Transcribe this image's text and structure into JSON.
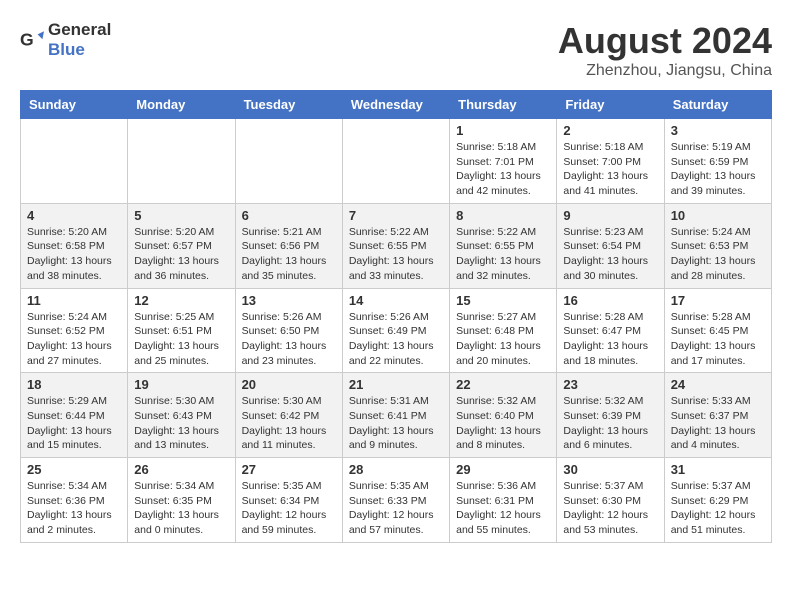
{
  "header": {
    "logo_general": "General",
    "logo_blue": "Blue",
    "title": "August 2024",
    "subtitle": "Zhenzhou, Jiangsu, China"
  },
  "weekdays": [
    "Sunday",
    "Monday",
    "Tuesday",
    "Wednesday",
    "Thursday",
    "Friday",
    "Saturday"
  ],
  "weeks": [
    [
      {
        "day": "",
        "info": ""
      },
      {
        "day": "",
        "info": ""
      },
      {
        "day": "",
        "info": ""
      },
      {
        "day": "",
        "info": ""
      },
      {
        "day": "1",
        "info": "Sunrise: 5:18 AM\nSunset: 7:01 PM\nDaylight: 13 hours\nand 42 minutes."
      },
      {
        "day": "2",
        "info": "Sunrise: 5:18 AM\nSunset: 7:00 PM\nDaylight: 13 hours\nand 41 minutes."
      },
      {
        "day": "3",
        "info": "Sunrise: 5:19 AM\nSunset: 6:59 PM\nDaylight: 13 hours\nand 39 minutes."
      }
    ],
    [
      {
        "day": "4",
        "info": "Sunrise: 5:20 AM\nSunset: 6:58 PM\nDaylight: 13 hours\nand 38 minutes."
      },
      {
        "day": "5",
        "info": "Sunrise: 5:20 AM\nSunset: 6:57 PM\nDaylight: 13 hours\nand 36 minutes."
      },
      {
        "day": "6",
        "info": "Sunrise: 5:21 AM\nSunset: 6:56 PM\nDaylight: 13 hours\nand 35 minutes."
      },
      {
        "day": "7",
        "info": "Sunrise: 5:22 AM\nSunset: 6:55 PM\nDaylight: 13 hours\nand 33 minutes."
      },
      {
        "day": "8",
        "info": "Sunrise: 5:22 AM\nSunset: 6:55 PM\nDaylight: 13 hours\nand 32 minutes."
      },
      {
        "day": "9",
        "info": "Sunrise: 5:23 AM\nSunset: 6:54 PM\nDaylight: 13 hours\nand 30 minutes."
      },
      {
        "day": "10",
        "info": "Sunrise: 5:24 AM\nSunset: 6:53 PM\nDaylight: 13 hours\nand 28 minutes."
      }
    ],
    [
      {
        "day": "11",
        "info": "Sunrise: 5:24 AM\nSunset: 6:52 PM\nDaylight: 13 hours\nand 27 minutes."
      },
      {
        "day": "12",
        "info": "Sunrise: 5:25 AM\nSunset: 6:51 PM\nDaylight: 13 hours\nand 25 minutes."
      },
      {
        "day": "13",
        "info": "Sunrise: 5:26 AM\nSunset: 6:50 PM\nDaylight: 13 hours\nand 23 minutes."
      },
      {
        "day": "14",
        "info": "Sunrise: 5:26 AM\nSunset: 6:49 PM\nDaylight: 13 hours\nand 22 minutes."
      },
      {
        "day": "15",
        "info": "Sunrise: 5:27 AM\nSunset: 6:48 PM\nDaylight: 13 hours\nand 20 minutes."
      },
      {
        "day": "16",
        "info": "Sunrise: 5:28 AM\nSunset: 6:47 PM\nDaylight: 13 hours\nand 18 minutes."
      },
      {
        "day": "17",
        "info": "Sunrise: 5:28 AM\nSunset: 6:45 PM\nDaylight: 13 hours\nand 17 minutes."
      }
    ],
    [
      {
        "day": "18",
        "info": "Sunrise: 5:29 AM\nSunset: 6:44 PM\nDaylight: 13 hours\nand 15 minutes."
      },
      {
        "day": "19",
        "info": "Sunrise: 5:30 AM\nSunset: 6:43 PM\nDaylight: 13 hours\nand 13 minutes."
      },
      {
        "day": "20",
        "info": "Sunrise: 5:30 AM\nSunset: 6:42 PM\nDaylight: 13 hours\nand 11 minutes."
      },
      {
        "day": "21",
        "info": "Sunrise: 5:31 AM\nSunset: 6:41 PM\nDaylight: 13 hours\nand 9 minutes."
      },
      {
        "day": "22",
        "info": "Sunrise: 5:32 AM\nSunset: 6:40 PM\nDaylight: 13 hours\nand 8 minutes."
      },
      {
        "day": "23",
        "info": "Sunrise: 5:32 AM\nSunset: 6:39 PM\nDaylight: 13 hours\nand 6 minutes."
      },
      {
        "day": "24",
        "info": "Sunrise: 5:33 AM\nSunset: 6:37 PM\nDaylight: 13 hours\nand 4 minutes."
      }
    ],
    [
      {
        "day": "25",
        "info": "Sunrise: 5:34 AM\nSunset: 6:36 PM\nDaylight: 13 hours\nand 2 minutes."
      },
      {
        "day": "26",
        "info": "Sunrise: 5:34 AM\nSunset: 6:35 PM\nDaylight: 13 hours\nand 0 minutes."
      },
      {
        "day": "27",
        "info": "Sunrise: 5:35 AM\nSunset: 6:34 PM\nDaylight: 12 hours\nand 59 minutes."
      },
      {
        "day": "28",
        "info": "Sunrise: 5:35 AM\nSunset: 6:33 PM\nDaylight: 12 hours\nand 57 minutes."
      },
      {
        "day": "29",
        "info": "Sunrise: 5:36 AM\nSunset: 6:31 PM\nDaylight: 12 hours\nand 55 minutes."
      },
      {
        "day": "30",
        "info": "Sunrise: 5:37 AM\nSunset: 6:30 PM\nDaylight: 12 hours\nand 53 minutes."
      },
      {
        "day": "31",
        "info": "Sunrise: 5:37 AM\nSunset: 6:29 PM\nDaylight: 12 hours\nand 51 minutes."
      }
    ]
  ]
}
